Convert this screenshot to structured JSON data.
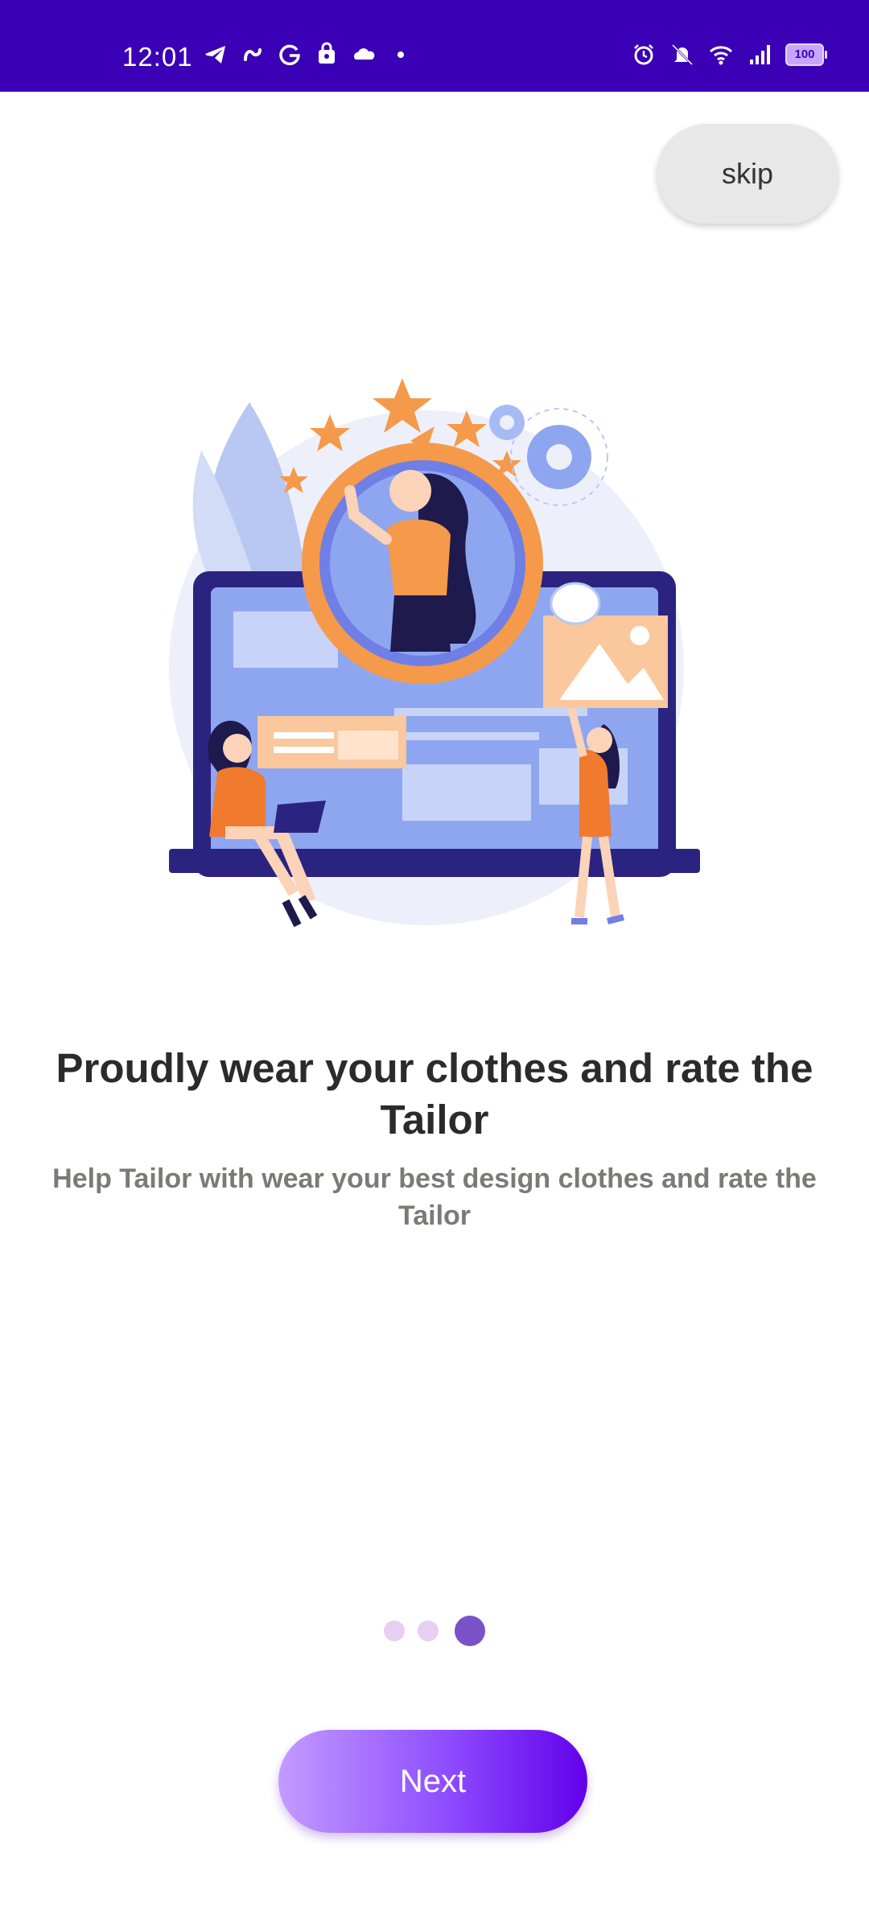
{
  "status_bar": {
    "time": "12:01",
    "battery": "100",
    "left_icons": [
      "telegram-icon",
      "brand-s-icon",
      "google-icon",
      "shopping-bag-icon",
      "cloud-icon",
      "dot-icon"
    ],
    "right_icons": [
      "alarm-icon",
      "mute-icon",
      "wifi-icon",
      "signal-icon",
      "battery-icon"
    ]
  },
  "onboarding": {
    "skip_label": "skip",
    "title": "Proudly wear your clothes and rate the Tailor",
    "subtitle": "Help Tailor with wear your best design clothes and rate the Tailor",
    "page_indicator": {
      "total": 3,
      "current": 3
    },
    "next_label": "Next"
  },
  "colors": {
    "status_bar": "#3b00b5",
    "accent_orange": "#f59a4a",
    "accent_purple": "#6200ea",
    "dot_active": "#7a52c7",
    "dot_inactive": "#e6cff3"
  }
}
